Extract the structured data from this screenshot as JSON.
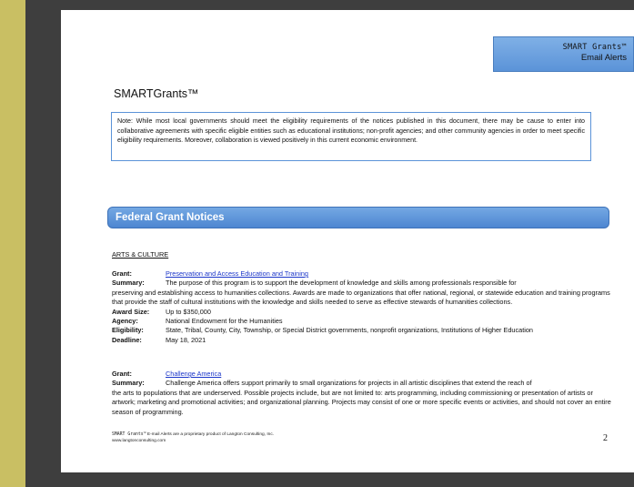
{
  "brand": {
    "line1": "SMART Grants™",
    "line2": "Email Alerts"
  },
  "doc_title": "SMARTGrants™",
  "note": "Note: While most local governments should meet the eligibility requirements of the notices published in this document, there may be cause to enter into collaborative agreements with specific eligible entities such as educational institutions; non-profit agencies; and other community agencies in order to meet specific eligibility requirements. Moreover, collaboration is viewed positively in this current economic environment.",
  "section_heading": "Federal Grant Notices",
  "category": "ARTS & CULTURE",
  "labels": {
    "grant": "Grant:",
    "summary": "Summary:",
    "award_size": "Award Size:",
    "agency": "Agency:",
    "eligibility": "Eligibility:",
    "deadline": "Deadline:"
  },
  "grants": [
    {
      "title": "Preservation and Access Education and Training",
      "summary_first": "The purpose of this program is to support the development of knowledge and skills among professionals responsible for",
      "summary_rest": "preserving and establishing access to humanities collections. Awards are made to organizations that offer national, regional, or statewide education and training programs that provide the staff of cultural institutions with the knowledge and skills needed to serve as effective stewards of humanities collections.",
      "award_size": "Up to $350,000",
      "agency": "National Endowment for the Humanities",
      "eligibility": "State, Tribal, County, City, Township, or Special District governments, nonprofit organizations, Institutions of Higher Education",
      "deadline": "May 18, 2021"
    },
    {
      "title": "Challenge America",
      "summary_first": "Challenge America offers support primarily to small organizations for projects in all artistic disciplines that extend the reach of",
      "summary_rest": "the arts to populations that are underserved. Possible projects include, but are not limited to: arts programming, including commissioning or presentation of artists or artwork; marketing and promotional activities; and organizational planning. Projects may consist of one or more specific events or activities, and should not cover an entire season of programming."
    }
  ],
  "footer": {
    "brand": "SMART Grants™",
    "text": " E-mail Alerts are a proprietary product of Langton Consulting, Inc.",
    "url": "www.langtonconsulting.com"
  },
  "page_number": "2"
}
